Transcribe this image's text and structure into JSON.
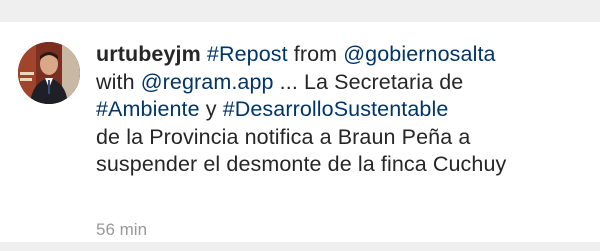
{
  "comment": {
    "username": "urtubeyjm",
    "tag_repost": "#Repost",
    "text_from": " from ",
    "mention_gobierno": "@gobiernosalta",
    "text_with": "with ",
    "mention_regram": "@regram.app",
    "text_mid": " ... La Secretaria de",
    "tag_ambiente": "#Ambiente",
    "text_y": " y ",
    "tag_desarrollo": "#DesarrolloSustentable",
    "text_line4": "de la Provincia notifica a Braun Peña a",
    "text_line5": "suspender el desmonte de la finca Cuchuy"
  },
  "timestamp": "56 min",
  "colors": {
    "link": "#003569",
    "text": "#262626",
    "timestamp": "#999999"
  },
  "icons": {
    "avatar": "profile-photo"
  }
}
